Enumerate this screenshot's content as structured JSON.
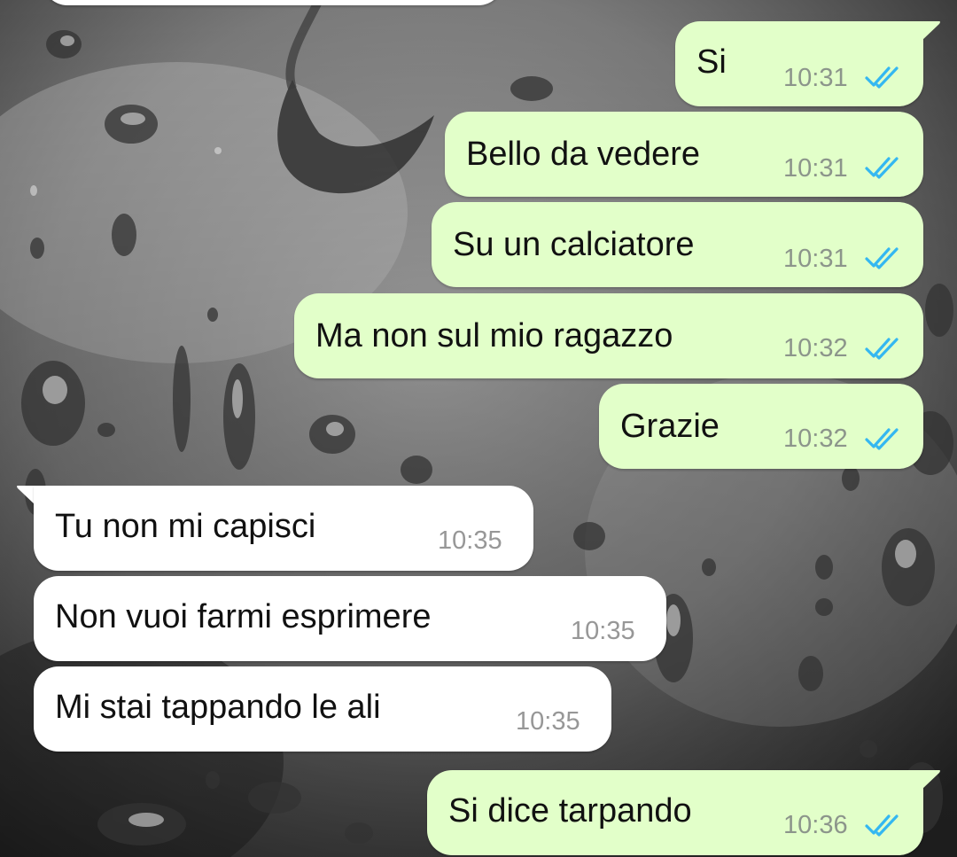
{
  "messages": [
    {
      "direction": "out",
      "text": "Si",
      "time": "10:31",
      "status": "read"
    },
    {
      "direction": "out",
      "text": "Bello da vedere",
      "time": "10:31",
      "status": "read"
    },
    {
      "direction": "out",
      "text": "Su un calciatore",
      "time": "10:31",
      "status": "read"
    },
    {
      "direction": "out",
      "text": "Ma non sul mio ragazzo",
      "time": "10:32",
      "status": "read"
    },
    {
      "direction": "out",
      "text": "Grazie",
      "time": "10:32",
      "status": "read"
    },
    {
      "direction": "in",
      "text": "Tu non mi capisci",
      "time": "10:35"
    },
    {
      "direction": "in",
      "text": "Non vuoi farmi esprimere",
      "time": "10:35"
    },
    {
      "direction": "in",
      "text": "Mi stai tappando le ali",
      "time": "10:35"
    },
    {
      "direction": "out",
      "text": "Si dice tarpando",
      "time": "10:36",
      "status": "read"
    }
  ],
  "colors": {
    "outgoing_bubble": "#e2ffc9",
    "incoming_bubble": "#ffffff",
    "read_tick": "#34b7f1",
    "timestamp": "#8c958b"
  },
  "icons": {
    "read_receipt": "double-check-icon"
  }
}
